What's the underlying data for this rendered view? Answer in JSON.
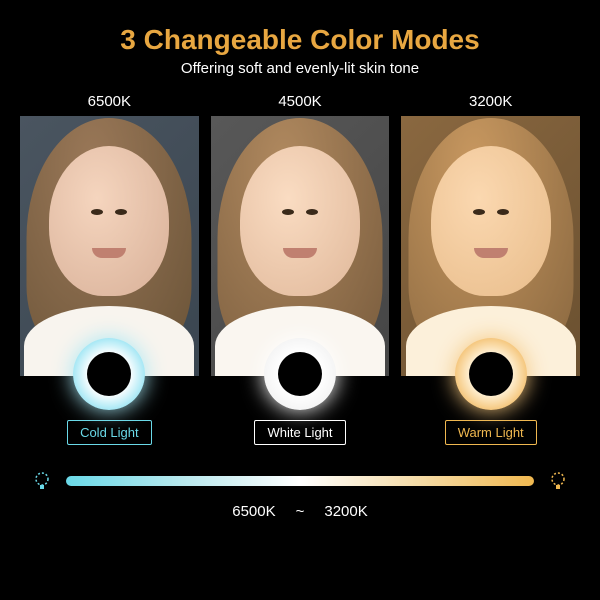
{
  "title": "3 Changeable Color Modes",
  "subtitle": "Offering soft and evenly-lit skin tone",
  "panels": [
    {
      "temp": "6500K",
      "label": "Cold Light"
    },
    {
      "temp": "4500K",
      "label": "White Light"
    },
    {
      "temp": "3200K",
      "label": "Warm Light"
    }
  ],
  "scale": {
    "from": "6500K",
    "sep": "~",
    "to": "3200K"
  }
}
